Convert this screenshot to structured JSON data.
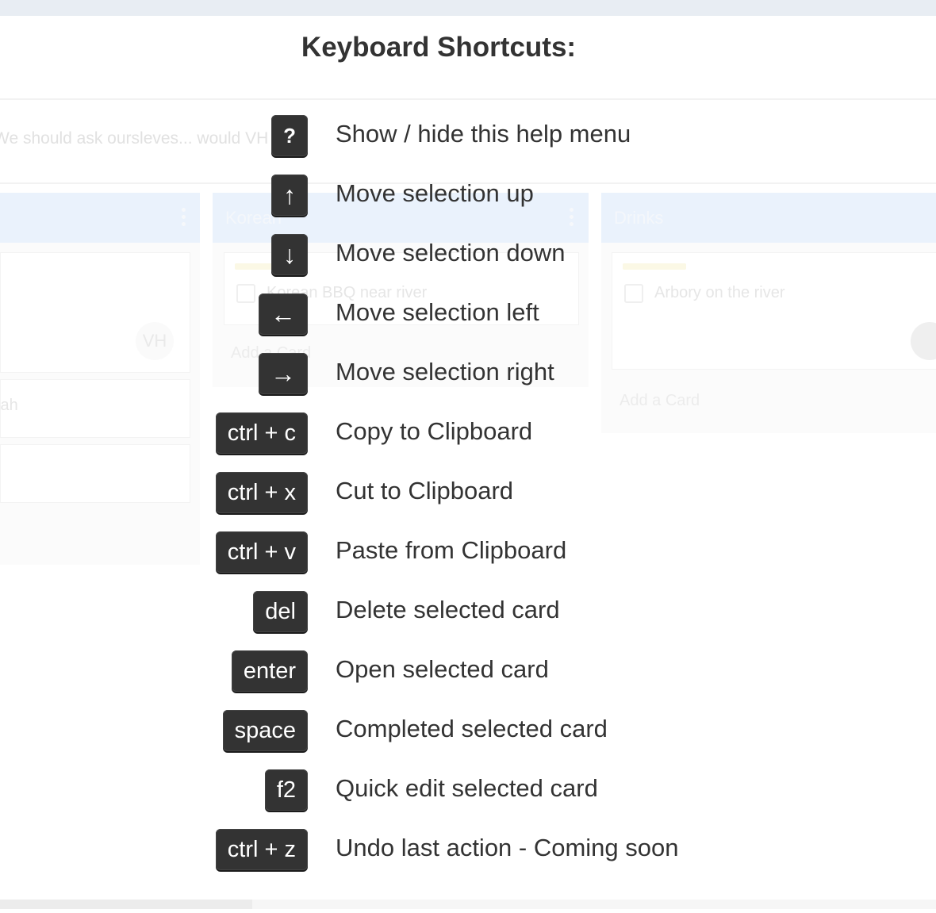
{
  "board": {
    "description_text": "We should ask oursleves... would VH",
    "lists": [
      {
        "title": "",
        "cards": [
          {
            "avatar": "VH"
          },
          {
            "text": "lah"
          }
        ]
      },
      {
        "title": "Korean",
        "cards": [
          {
            "text": "Korean BBQ near river"
          }
        ],
        "add_card_label": "Add a Card"
      },
      {
        "title": "Drinks",
        "cards": [
          {
            "text": "Arbory on the river"
          }
        ],
        "add_card_label": "Add a Card"
      }
    ]
  },
  "help": {
    "title": "Keyboard Shortcuts:",
    "shortcuts": [
      {
        "key": "?",
        "description": "Show / hide this help menu"
      },
      {
        "key": "↑",
        "description": "Move selection up"
      },
      {
        "key": "↓",
        "description": "Move selection down"
      },
      {
        "key": "←",
        "description": "Move selection left"
      },
      {
        "key": "→",
        "description": "Move selection right"
      },
      {
        "key": "ctrl + c",
        "description": "Copy to Clipboard"
      },
      {
        "key": "ctrl + x",
        "description": "Cut to Clipboard"
      },
      {
        "key": "ctrl + v",
        "description": "Paste from Clipboard"
      },
      {
        "key": "del",
        "description": "Delete selected card"
      },
      {
        "key": "enter",
        "description": "Open selected card"
      },
      {
        "key": "space",
        "description": "Completed selected card"
      },
      {
        "key": "f2",
        "description": "Quick edit selected card"
      },
      {
        "key": "ctrl + z",
        "description": "Undo last action - Coming soon"
      }
    ]
  }
}
